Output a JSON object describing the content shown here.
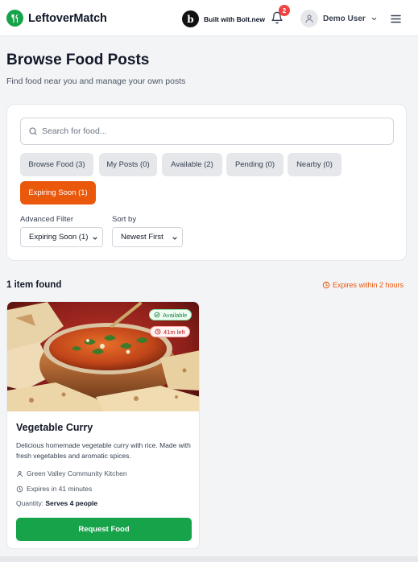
{
  "header": {
    "app_name": "LeftoverMatch",
    "bolt_text": "Built with Bolt.new",
    "bolt_letter": "b",
    "notification_count": "2",
    "user_name": "Demo User",
    "accent": "#16a34a"
  },
  "page": {
    "title": "Browse Food Posts",
    "subtitle": "Find food near you and manage your own posts"
  },
  "search": {
    "placeholder": "Search for food...",
    "value": ""
  },
  "tabs": [
    {
      "label": "Browse Food (3)",
      "active": false
    },
    {
      "label": "My Posts (0)",
      "active": false
    },
    {
      "label": "Available (2)",
      "active": false
    },
    {
      "label": "Pending (0)",
      "active": false
    },
    {
      "label": "Nearby (0)",
      "active": false
    },
    {
      "label": "Expiring Soon (1)",
      "active": true
    }
  ],
  "filters": {
    "advanced_label": "Advanced Filter",
    "advanced_value": "Expiring Soon (1)",
    "sort_label": "Sort by",
    "sort_value": "Newest First"
  },
  "results": {
    "count_text": "1 item found",
    "expire_note": "Expires within 2 hours"
  },
  "food_card": {
    "status_badge": "Available",
    "time_badge": "41m left",
    "title": "Vegetable Curry",
    "description": "Delicious homemade vegetable curry with rice. Made with fresh vegetables and aromatic spices.",
    "location": "Green Valley Community Kitchen",
    "expires": "Expires in 41 minutes",
    "quantity_label": "Quantity:",
    "quantity_value": "Serves 4 people",
    "button_label": "Request Food"
  },
  "colors": {
    "primary": "#16a34a",
    "orange": "#ea580c",
    "danger": "#ef4444"
  },
  "icons": [
    "utensils-icon",
    "bolt-logo",
    "bell-icon",
    "user-icon",
    "chevron-down-icon",
    "menu-icon",
    "search-icon",
    "clock-icon",
    "check-circle-icon",
    "user-pin-icon"
  ]
}
